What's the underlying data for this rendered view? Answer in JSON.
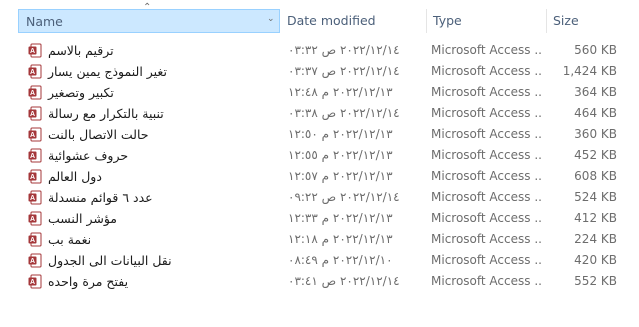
{
  "header": {
    "name_label": "Name",
    "date_label": "Date modified",
    "type_label": "Type",
    "size_label": "Size",
    "sort_icon": "sort-ascending-icon",
    "chevron_icon": "chevron-down-icon"
  },
  "colors": {
    "selected_header_bg": "#cce8ff",
    "selected_header_border": "#99d1ff",
    "access_red": "#a4373a",
    "secondary_text": "#6d6d6d"
  },
  "files": [
    {
      "name": "ترقيم بالاسم",
      "date": "٢٠٢٢/١٢/١٤ ص ٠٣:٣٢",
      "type": "Microsoft Access ...",
      "size": "560 KB",
      "icon": "access-database-icon"
    },
    {
      "name": "تغير النموذج يمين يسار",
      "date": "٢٠٢٢/١٢/١٤ ص ٠٣:٣٧",
      "type": "Microsoft Access ...",
      "size": "1,424 KB",
      "icon": "access-database-icon"
    },
    {
      "name": "تكبير وتصغير",
      "date": "٢٠٢٢/١٢/١٣ م ١٢:٤٨",
      "type": "Microsoft Access ...",
      "size": "364 KB",
      "icon": "access-database-icon"
    },
    {
      "name": "تنبية بالتكرار مع رسالة",
      "date": "٢٠٢٢/١٢/١٤ ص ٠٣:٣٨",
      "type": "Microsoft Access ...",
      "size": "464 KB",
      "icon": "access-database-icon"
    },
    {
      "name": "حالت الاتصال بالنت",
      "date": "٢٠٢٢/١٢/١٣ م ١٢:٥٠",
      "type": "Microsoft Access ...",
      "size": "360 KB",
      "icon": "access-database-icon"
    },
    {
      "name": "حروف عشوائية",
      "date": "٢٠٢٢/١٢/١٣ م ١٢:٥٥",
      "type": "Microsoft Access ...",
      "size": "452 KB",
      "icon": "access-database-icon"
    },
    {
      "name": "دول العالم",
      "date": "٢٠٢٢/١٢/١٣ م ١٢:٥٧",
      "type": "Microsoft Access ...",
      "size": "608 KB",
      "icon": "access-database-icon"
    },
    {
      "name": "عدد ٦ قوائم منسدلة",
      "date": "٢٠٢٢/١٢/١٤ ص ٠٩:٢٢",
      "type": "Microsoft Access ...",
      "size": "524 KB",
      "icon": "access-database-icon"
    },
    {
      "name": "مؤشر النسب",
      "date": "٢٠٢٢/١٢/١٣ م ١٢:٣٣",
      "type": "Microsoft Access ...",
      "size": "412 KB",
      "icon": "access-database-icon"
    },
    {
      "name": "نغمة بب",
      "date": "٢٠٢٢/١٢/١٣ م ١٢:١٨",
      "type": "Microsoft Access ...",
      "size": "224 KB",
      "icon": "access-database-icon"
    },
    {
      "name": "نقل البيانات الى الجدول",
      "date": "٢٠٢٢/١٢/١٠ م ٠٨:٤٩",
      "type": "Microsoft Access ...",
      "size": "420 KB",
      "icon": "access-database-icon"
    },
    {
      "name": "يفتح مرة واحده",
      "date": "٢٠٢٢/١٢/١٤ ص ٠٣:٤١",
      "type": "Microsoft Access ...",
      "size": "552 KB",
      "icon": "access-database-icon"
    }
  ]
}
